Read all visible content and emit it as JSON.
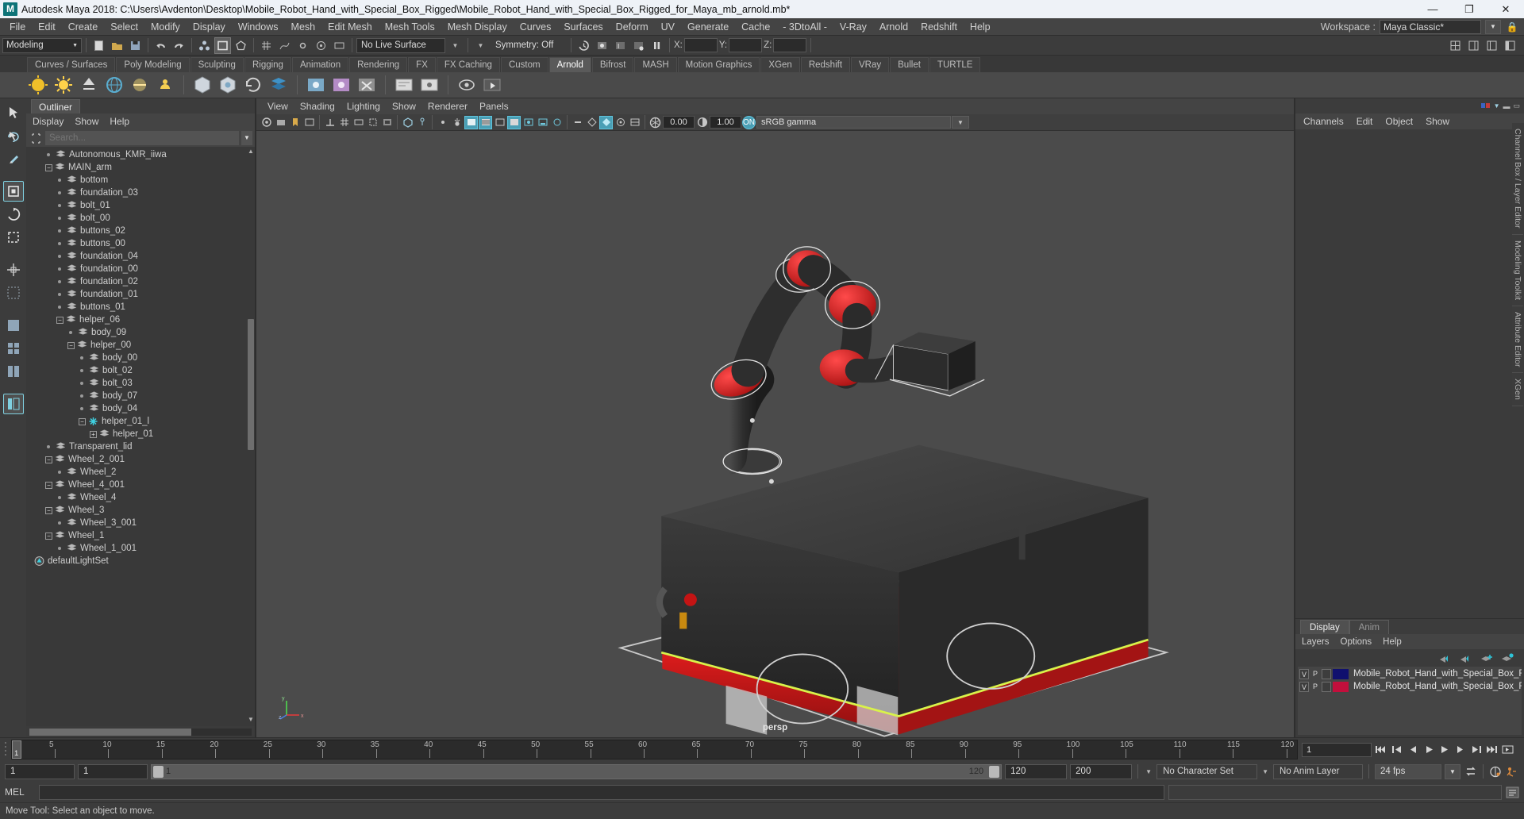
{
  "window": {
    "title": "Autodesk Maya 2018: C:\\Users\\Avdenton\\Desktop\\Mobile_Robot_Hand_with_Special_Box_Rigged\\Mobile_Robot_Hand_with_Special_Box_Rigged_for_Maya_mb_arnold.mb*",
    "logo": "M",
    "minimize": "—",
    "maximize": "❐",
    "close": "✕"
  },
  "menubar": {
    "items": [
      "File",
      "Edit",
      "Create",
      "Select",
      "Modify",
      "Display",
      "Windows",
      "Mesh",
      "Edit Mesh",
      "Mesh Tools",
      "Mesh Display",
      "Curves",
      "Surfaces",
      "Deform",
      "UV",
      "Generate",
      "Cache",
      "- 3DtoAll -",
      "V-Ray",
      "Arnold",
      "Redshift",
      "Help"
    ],
    "workspace_label": "Workspace :",
    "workspace_value": "Maya Classic*"
  },
  "statusline": {
    "mode": "Modeling",
    "live_surface": "No Live Surface",
    "symmetry": "Symmetry: Off",
    "x_label": "X:",
    "y_label": "Y:",
    "z_label": "Z:",
    "x_value": "",
    "y_value": "",
    "z_value": ""
  },
  "shelf": {
    "tabs": [
      "Curves / Surfaces",
      "Poly Modeling",
      "Sculpting",
      "Rigging",
      "Animation",
      "Rendering",
      "FX",
      "FX Caching",
      "Custom",
      "Arnold",
      "Bifrost",
      "MASH",
      "Motion Graphics",
      "XGen",
      "Redshift",
      "VRay",
      "Bullet",
      "TURTLE"
    ],
    "active_tab": "Arnold"
  },
  "outliner": {
    "tab": "Outliner",
    "menus": [
      "Display",
      "Show",
      "Help"
    ],
    "search_placeholder": "Search...",
    "search_value": "",
    "tree": [
      {
        "label": "Autonomous_KMR_iiwa",
        "depth": 1,
        "marker": "dot",
        "icon": "mesh"
      },
      {
        "label": "MAIN_arm",
        "depth": 1,
        "marker": "minus",
        "icon": "mesh"
      },
      {
        "label": "bottom",
        "depth": 2,
        "marker": "dot",
        "icon": "mesh"
      },
      {
        "label": "foundation_03",
        "depth": 2,
        "marker": "dot",
        "icon": "mesh"
      },
      {
        "label": "bolt_01",
        "depth": 2,
        "marker": "dot",
        "icon": "mesh"
      },
      {
        "label": "bolt_00",
        "depth": 2,
        "marker": "dot",
        "icon": "mesh"
      },
      {
        "label": "buttons_02",
        "depth": 2,
        "marker": "dot",
        "icon": "mesh"
      },
      {
        "label": "buttons_00",
        "depth": 2,
        "marker": "dot",
        "icon": "mesh"
      },
      {
        "label": "foundation_04",
        "depth": 2,
        "marker": "dot",
        "icon": "mesh"
      },
      {
        "label": "foundation_00",
        "depth": 2,
        "marker": "dot",
        "icon": "mesh"
      },
      {
        "label": "foundation_02",
        "depth": 2,
        "marker": "dot",
        "icon": "mesh"
      },
      {
        "label": "foundation_01",
        "depth": 2,
        "marker": "dot",
        "icon": "mesh"
      },
      {
        "label": "buttons_01",
        "depth": 2,
        "marker": "dot",
        "icon": "mesh"
      },
      {
        "label": "helper_06",
        "depth": 2,
        "marker": "minus",
        "icon": "mesh"
      },
      {
        "label": "body_09",
        "depth": 3,
        "marker": "dot",
        "icon": "mesh"
      },
      {
        "label": "helper_00",
        "depth": 3,
        "marker": "minus",
        "icon": "mesh"
      },
      {
        "label": "body_00",
        "depth": 4,
        "marker": "dot",
        "icon": "mesh"
      },
      {
        "label": "bolt_02",
        "depth": 4,
        "marker": "dot",
        "icon": "mesh"
      },
      {
        "label": "bolt_03",
        "depth": 4,
        "marker": "dot",
        "icon": "mesh"
      },
      {
        "label": "body_07",
        "depth": 4,
        "marker": "dot",
        "icon": "mesh"
      },
      {
        "label": "body_04",
        "depth": 4,
        "marker": "dot",
        "icon": "mesh"
      },
      {
        "label": "helper_01_l",
        "depth": 4,
        "marker": "minus",
        "icon": "joint"
      },
      {
        "label": "helper_01",
        "depth": 5,
        "marker": "plus",
        "icon": "mesh"
      },
      {
        "label": "Transparent_lid",
        "depth": 1,
        "marker": "dot",
        "icon": "mesh"
      },
      {
        "label": "Wheel_2_001",
        "depth": 1,
        "marker": "minus",
        "icon": "mesh"
      },
      {
        "label": "Wheel_2",
        "depth": 2,
        "marker": "dot",
        "icon": "mesh"
      },
      {
        "label": "Wheel_4_001",
        "depth": 1,
        "marker": "minus",
        "icon": "mesh"
      },
      {
        "label": "Wheel_4",
        "depth": 2,
        "marker": "dot",
        "icon": "mesh"
      },
      {
        "label": "Wheel_3",
        "depth": 1,
        "marker": "minus",
        "icon": "mesh"
      },
      {
        "label": "Wheel_3_001",
        "depth": 2,
        "marker": "dot",
        "icon": "mesh"
      },
      {
        "label": "Wheel_1",
        "depth": 1,
        "marker": "minus",
        "icon": "mesh"
      },
      {
        "label": "Wheel_1_001",
        "depth": 2,
        "marker": "dot",
        "icon": "mesh"
      },
      {
        "label": "defaultLightSet",
        "depth": 0,
        "marker": "none",
        "icon": "lightset"
      }
    ]
  },
  "viewport": {
    "menus": [
      "View",
      "Shading",
      "Lighting",
      "Show",
      "Renderer",
      "Panels"
    ],
    "exposure": "0.00",
    "gamma": "1.00",
    "gamma_toggle": "ON",
    "color_space": "sRGB gamma",
    "camera_label": "persp",
    "axis": {
      "x": "x",
      "y": "y",
      "z": "z"
    }
  },
  "channelbox": {
    "menus": [
      "Channels",
      "Edit",
      "Object",
      "Show"
    ]
  },
  "layers": {
    "tabs": [
      "Display",
      "Anim"
    ],
    "active_tab": "Display",
    "menus": [
      "Layers",
      "Options",
      "Help"
    ],
    "rows": [
      {
        "v": "V",
        "p": "P",
        "third": "",
        "color": "#10106e",
        "name": "Mobile_Robot_Hand_with_Special_Box_Rigged_Controll"
      },
      {
        "v": "V",
        "p": "P",
        "third": "",
        "color": "#c20f3c",
        "name": "Mobile_Robot_Hand_with_Special_Box_Rigged_Geometr"
      }
    ]
  },
  "verticaltabs": [
    "Channel Box / Layer Editor",
    "Modeling Toolkit",
    "Attribute Editor",
    "XGen"
  ],
  "timeline": {
    "ticks": [
      5,
      10,
      15,
      20,
      25,
      30,
      35,
      40,
      45,
      50,
      55,
      60,
      65,
      70,
      75,
      80,
      85,
      90,
      95,
      100,
      105,
      110,
      115,
      120
    ],
    "current_frame": "1",
    "range_start": 1,
    "range_end": 120,
    "field_value": "1"
  },
  "rangebar": {
    "anim_start": "1",
    "playback_start": "1",
    "slider_min": "1",
    "slider_max": "120",
    "playback_end": "120",
    "anim_end": "200",
    "character_set": "No Character Set",
    "anim_layer": "No Anim Layer",
    "fps": "24 fps"
  },
  "melbar": {
    "label": "MEL",
    "command": ""
  },
  "statusbar": {
    "text": "Move Tool: Select an object to move."
  }
}
